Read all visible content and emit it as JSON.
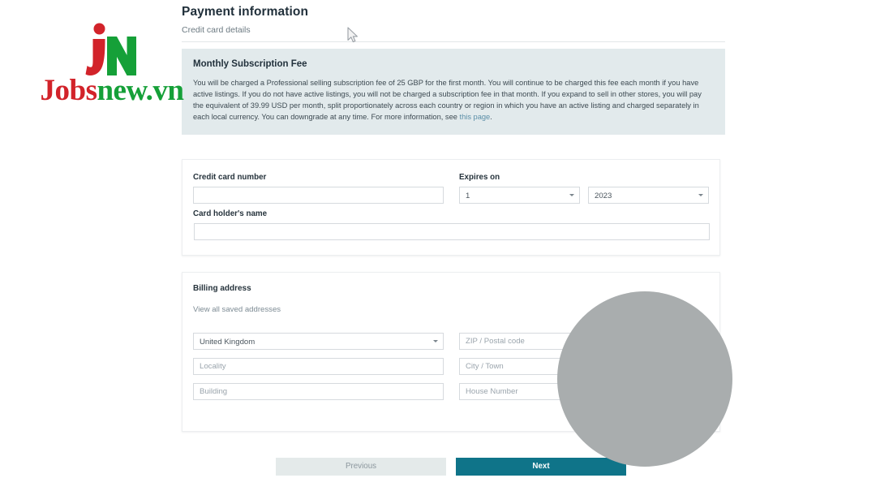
{
  "watermark": {
    "mark_left": "J",
    "mark_right": "N",
    "word_part1": "Jobs",
    "word_part2": "new.vn",
    "color_red": "#d2232a",
    "color_green": "#15a038"
  },
  "header": {
    "title": "Payment information",
    "subtitle": "Credit card details"
  },
  "notice": {
    "title": "Monthly Subscription Fee",
    "body": "You will be charged a Professional selling subscription fee of 25 GBP for the first month. You will continue to be charged this fee each month if you have active listings. If you do not have active listings, you will not be charged a subscription fee in that month. If you expand to sell in other stores, you will pay the equivalent of 39.99 USD per month, split proportionately across each country or region in which you have an active listing and charged separately in each local currency. You can downgrade at any time. For more information, see ",
    "link_label": "this page",
    "body_end": ".",
    "background": "#e2eaec",
    "link_color": "#5b8fa8"
  },
  "credit_card": {
    "number_label": "Credit card number",
    "number_value": "",
    "number_placeholder": "",
    "name_label": "Card holder's name",
    "name_value": "",
    "name_placeholder": "",
    "expires_label": "Expires on",
    "expiry_month": "1",
    "expiry_year": "2023"
  },
  "billing": {
    "section_title": "Billing address",
    "saved_addresses_link": "View all saved addresses",
    "country": "United Kingdom",
    "zip_placeholder": "ZIP / Postal code",
    "zip_value": "",
    "locality_placeholder": "Locality",
    "locality_value": "",
    "city_placeholder": "City / Town",
    "city_value": "",
    "building_placeholder": "Building",
    "building_value": "",
    "house_placeholder": "House Number",
    "house_value": ""
  },
  "footer": {
    "previous_label": "Previous",
    "next_label": "Next",
    "next_color": "#0f7489",
    "previous_color": "#e4eaea"
  },
  "overlay": {
    "circle_color": "#a9adae"
  }
}
